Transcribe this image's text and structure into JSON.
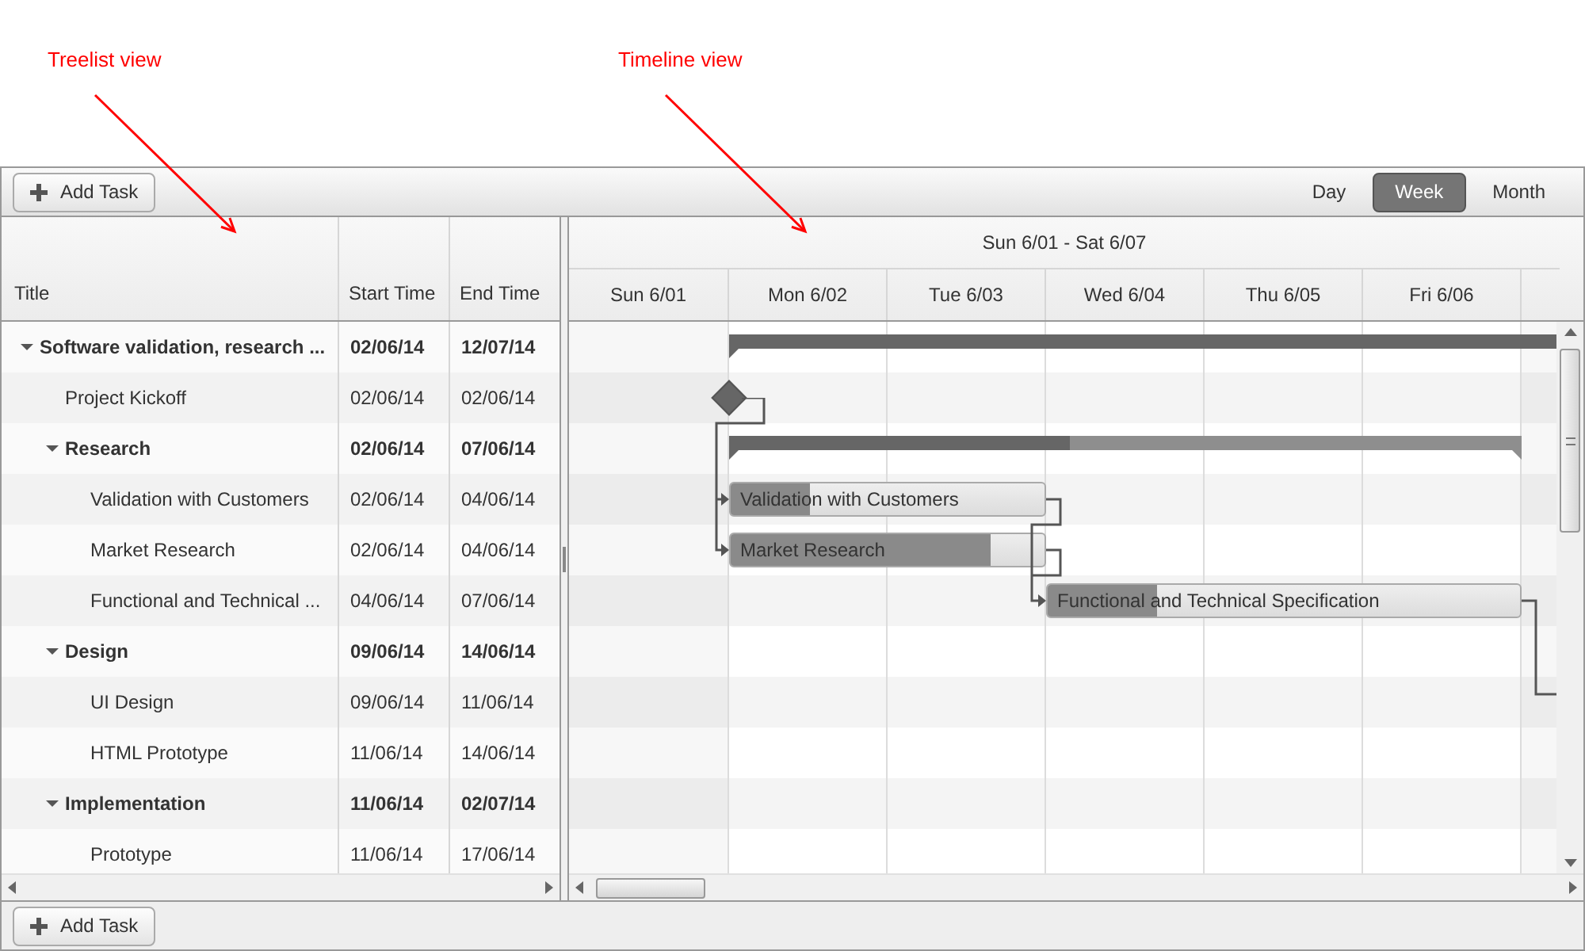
{
  "annotations": [
    {
      "text": "Treelist view"
    },
    {
      "text": "Timeline view"
    }
  ],
  "toolbar": {
    "add_task": "Add Task",
    "views": [
      {
        "label": "Day",
        "selected": false
      },
      {
        "label": "Week",
        "selected": true
      },
      {
        "label": "Month",
        "selected": false
      }
    ]
  },
  "treelist": {
    "columns": [
      "Title",
      "Start Time",
      "End Time"
    ],
    "rows": [
      {
        "title": "Software validation, research ...",
        "start": "02/06/14",
        "end": "12/07/14",
        "kind": "summary",
        "expanded": true,
        "children": [
          {
            "title": "Project Kickoff",
            "start": "02/06/14",
            "end": "02/06/14",
            "kind": "milestone"
          },
          {
            "title": "Research",
            "start": "02/06/14",
            "end": "07/06/14",
            "kind": "summary",
            "expanded": true,
            "level": 0.43,
            "children": [
              {
                "title": "Validation with Customers",
                "bar_label": "Validation with Customers",
                "start": "02/06/14",
                "end": "04/06/14",
                "kind": "task",
                "level": 0.25
              },
              {
                "title": "Market Research",
                "bar_label": "Market Research",
                "start": "02/06/14",
                "end": "04/06/14",
                "kind": "task",
                "level": 0.83
              },
              {
                "title": "Functional and Technical ...",
                "bar_label": "Functional and Technical Specification",
                "start": "04/06/14",
                "end": "07/06/14",
                "kind": "task",
                "level": 0.23
              }
            ]
          },
          {
            "title": "Design",
            "start": "09/06/14",
            "end": "14/06/14",
            "kind": "summary",
            "expanded": true,
            "children": [
              {
                "title": "UI Design",
                "start": "09/06/14",
                "end": "11/06/14",
                "kind": "task"
              },
              {
                "title": "HTML Prototype",
                "start": "11/06/14",
                "end": "14/06/14",
                "kind": "task"
              }
            ]
          },
          {
            "title": "Implementation",
            "start": "11/06/14",
            "end": "02/07/14",
            "kind": "summary",
            "expanded": true,
            "children": [
              {
                "title": "Prototype",
                "start": "11/06/14",
                "end": "17/06/14",
                "kind": "task"
              }
            ]
          }
        ]
      }
    ]
  },
  "timeline": {
    "range": "Sun 6/01 - Sat 6/07",
    "days": [
      "Sun 6/01",
      "Mon 6/02",
      "Tue 6/03",
      "Wed 6/04",
      "Thu 6/05",
      "Fri 6/06"
    ]
  },
  "footer": {
    "add_task": "Add Task"
  }
}
